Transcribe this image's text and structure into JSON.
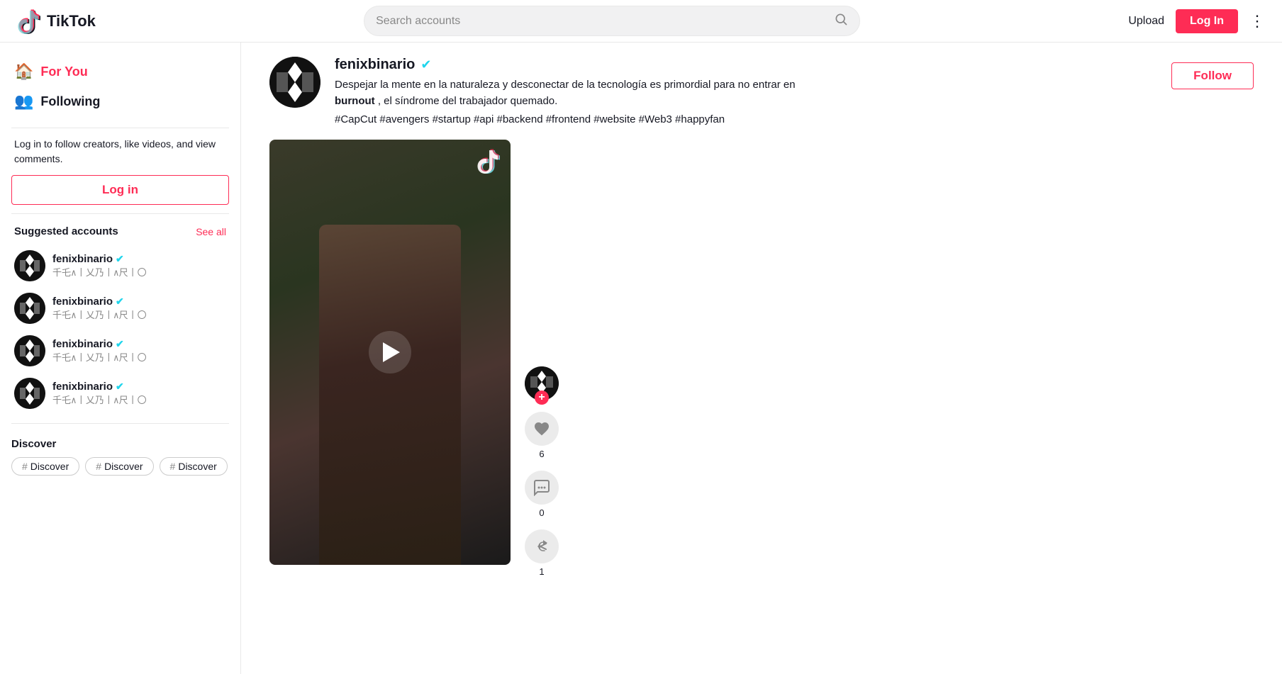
{
  "header": {
    "logo_text": "TikTok",
    "search_placeholder": "Search accounts",
    "upload_label": "Upload",
    "login_label": "Log In"
  },
  "sidebar": {
    "nav_items": [
      {
        "id": "for-you",
        "label": "For You",
        "icon": "🏠",
        "active": true
      },
      {
        "id": "following",
        "label": "Following",
        "icon": "👥",
        "active": false
      }
    ],
    "login_prompt": "Log in to follow creators, like videos, and view comments.",
    "log_in_button": "Log in",
    "suggested_label": "Suggested accounts",
    "see_all_label": "See all",
    "accounts": [
      {
        "username": "fenixbinario",
        "verified": true,
        "sub": "千乇∧丨乂乃丨∧尺丨〇"
      },
      {
        "username": "fenixbinario",
        "verified": true,
        "sub": "千乇∧丨乂乃丨∧尺丨〇"
      },
      {
        "username": "fenixbinario",
        "verified": true,
        "sub": "千乇∧丨乂乃丨∧尺丨〇"
      },
      {
        "username": "fenixbinario",
        "verified": true,
        "sub": "千乇∧丨乂乃丨∧尺丨〇"
      }
    ],
    "discover_label": "Discover",
    "discover_tags": [
      "Discover",
      "Discover",
      "Discover"
    ]
  },
  "profile": {
    "username": "fenixbinario",
    "verified": true,
    "bio_part1": "Despejar la mente en la naturaleza y desconectar de la tecnología es primordial para no entrar en",
    "bio_bold": "burnout",
    "bio_part2": ", el síndrome del trabajador quemado.",
    "tags": "#CapCut #avengers #startup #api #backend #frontend #website #Web3 #happyfan",
    "follow_label": "Follow"
  },
  "video": {
    "tiktok_icon": "♪",
    "play_label": "Play",
    "like_count": "6",
    "comment_count": "0",
    "share_count": "1"
  },
  "actions": {
    "like_icon": "♥",
    "comment_icon": "💬",
    "share_icon": "↩"
  }
}
